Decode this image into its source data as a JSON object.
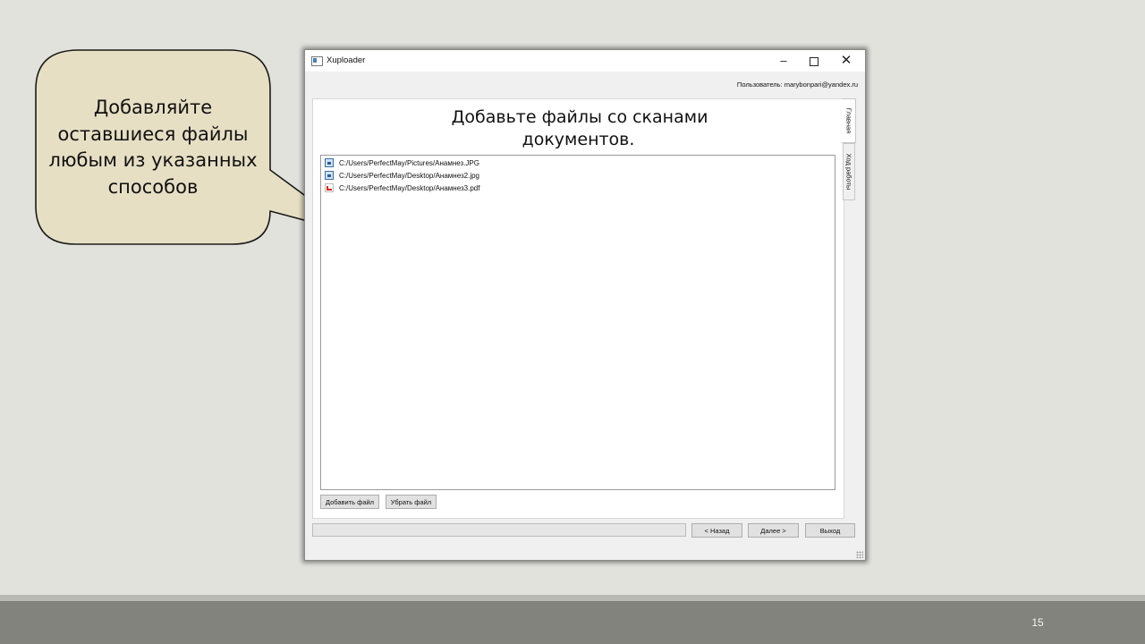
{
  "callout": {
    "lines": [
      "Добавляйте",
      "оставшиеся файлы",
      "любым из указанных",
      "способов"
    ],
    "fill_color": "#e6dfc4"
  },
  "window": {
    "title": "Xuploader",
    "controls": {
      "minimize": "–",
      "maximize": "",
      "close": "✕"
    },
    "user_label": "Пользователь:  marybonpari@yandex.ru",
    "heading_line1": "Добавьте файлы со сканами",
    "heading_line2": "документов.",
    "files": [
      {
        "path": "C:/Users/PerfectMay/Pictures/Анамнез.JPG",
        "icon": "image-file-icon"
      },
      {
        "path": "C:/Users/PerfectMay/Desktop/Анамнез2.jpg",
        "icon": "image-file-icon"
      },
      {
        "path": "C:/Users/PerfectMay/Desktop/Анамнез3.pdf",
        "icon": "pdf-file-icon"
      }
    ],
    "buttons": {
      "add_file": "Добавить файл",
      "remove_file": "Убрать файл",
      "back": "< Назад",
      "next": "Далее >",
      "exit": "Выход"
    },
    "tabs": [
      "Главная",
      "Ход работы"
    ],
    "active_tab": "Главная"
  },
  "slide": {
    "page_number": "15"
  }
}
